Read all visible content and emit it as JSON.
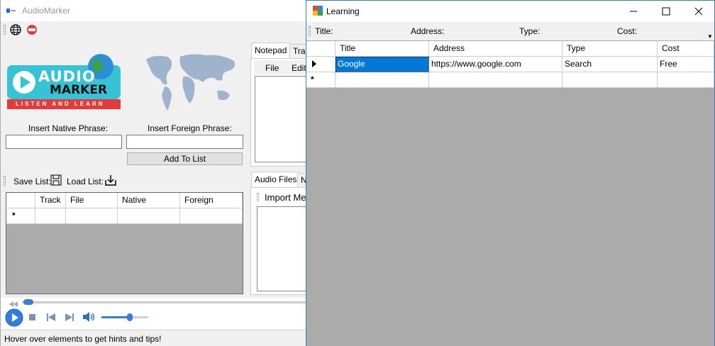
{
  "main": {
    "title": "AudioMarker",
    "logo_top": "AUDIO",
    "logo_bottom": "MARKER",
    "logo_sub": "LISTEN AND LEARN",
    "native_label": "Insert Native Phrase:",
    "foreign_label": "Insert Foreign Phrase:",
    "add_button": "Add To List",
    "save_list": "Save List:",
    "load_list": "Load List:",
    "columns": [
      "Track",
      "File",
      "Native",
      "Foreign"
    ],
    "new_row_marker": "*",
    "notepad_tab": "Notepad",
    "tran_tab": "Tran",
    "file_menu": "File",
    "edit_menu": "Edit",
    "audio_files_tab": "Audio Files",
    "n_tab": "N",
    "import_label": "Import Me",
    "status": "Hover over elements to get hints and tips!",
    "volume_level": 0.6
  },
  "learning": {
    "title": "Learning",
    "fields": [
      "Title:",
      "Address:",
      "Type:",
      "Cost:"
    ],
    "columns": [
      "Title",
      "Address",
      "Type",
      "Cost"
    ],
    "row": {
      "title": "Google",
      "address": "https://www.google.com",
      "type": "Search",
      "cost": "Free"
    },
    "new_row_marker": "*"
  },
  "colors": {
    "selection": "#0078d7",
    "grid_bg": "#ababab",
    "logo_teal": "#35c3d5",
    "logo_red": "#e33b3b"
  }
}
